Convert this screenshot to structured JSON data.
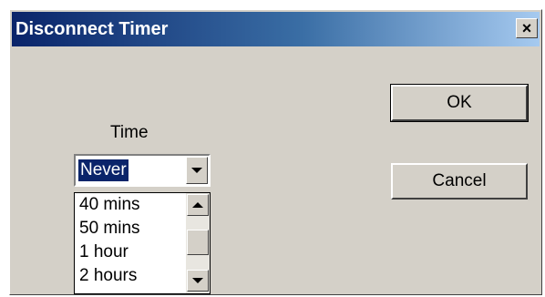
{
  "window": {
    "title": "Disconnect Timer",
    "close_glyph": "×"
  },
  "time_field": {
    "label": "Time",
    "selected_value": "Never",
    "dropdown_icon": "chevron-down-icon",
    "options_visible": [
      "40 mins",
      "50 mins",
      "1 hour",
      "2 hours"
    ]
  },
  "buttons": {
    "ok_label": "OK",
    "cancel_label": "Cancel"
  },
  "colors": {
    "titlebar_start": "#0a246a",
    "titlebar_end": "#a6caf0",
    "dialog_bg": "#d4d0c8",
    "selection_bg": "#0a246a"
  }
}
